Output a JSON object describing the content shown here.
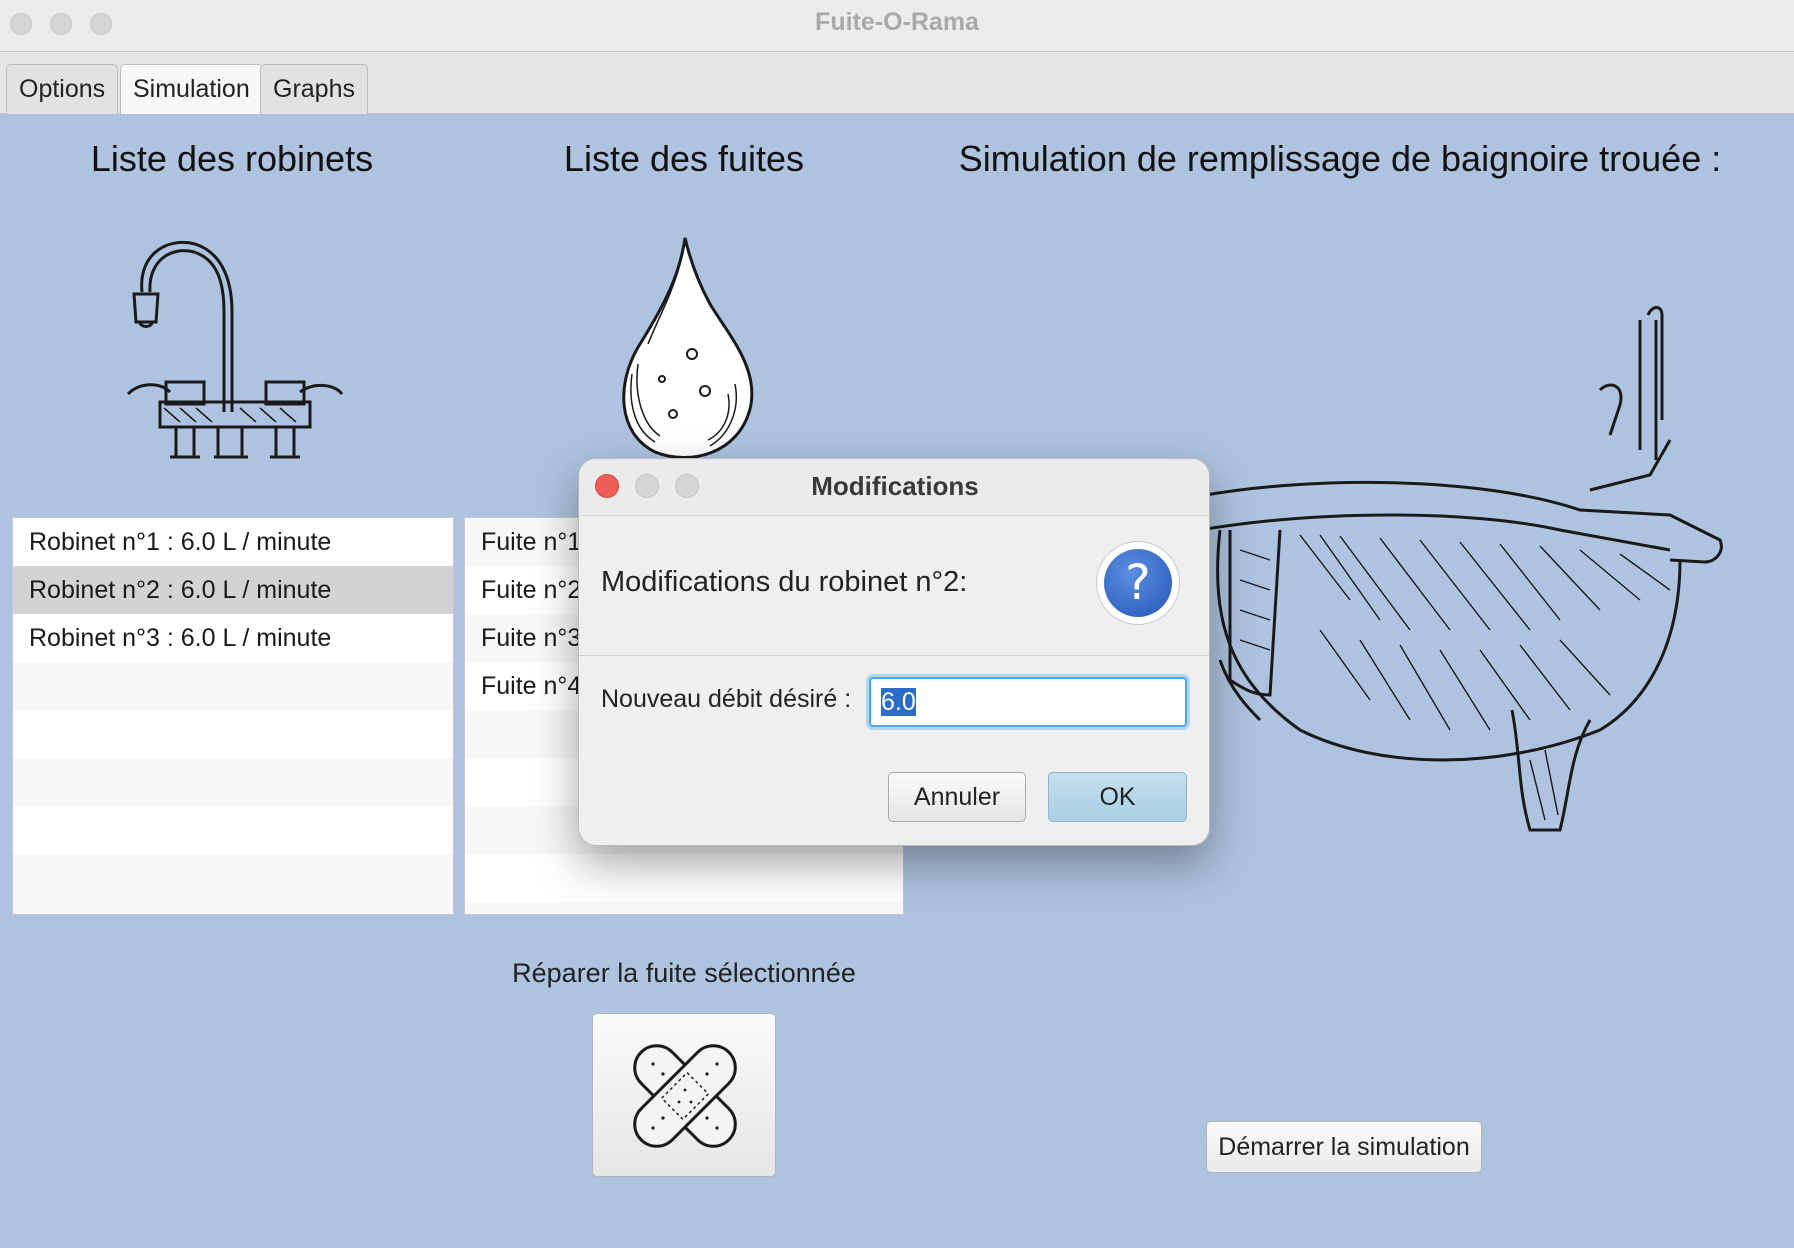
{
  "window": {
    "title": "Fuite-O-Rama"
  },
  "tabs": [
    {
      "label": "Options"
    },
    {
      "label": "Simulation"
    },
    {
      "label": "Graphs"
    }
  ],
  "sections": {
    "faucets_title": "Liste des robinets",
    "leaks_title": "Liste des fuites",
    "simulation_title": "Simulation de remplissage de baignoire trouée :"
  },
  "faucets": [
    "Robinet n°1 : 6.0 L / minute",
    "Robinet n°2 : 6.0 L / minute",
    "Robinet n°3 : 6.0 L / minute"
  ],
  "leaks": [
    "Fuite n°1:",
    "Fuite n°2",
    "Fuite n°3",
    "Fuite n°4"
  ],
  "repair": {
    "label": "Réparer la fuite sélectionnée"
  },
  "start_button": "Démarrer la simulation",
  "dialog": {
    "title": "Modifications",
    "message": "Modifications du robinet n°2:",
    "field_label": "Nouveau débit désiré :",
    "field_value": "6.0",
    "cancel": "Annuler",
    "ok": "OK"
  },
  "icons": {
    "faucet": "faucet-icon",
    "drop": "water-drop-icon",
    "bathtub": "bathtub-icon",
    "bandage": "bandage-icon",
    "question": "question-icon"
  },
  "colors": {
    "background": "#adc3df",
    "selection": "#d3d3d3",
    "ok_button": "#a9cfe4",
    "close_light": "#ec5e56",
    "question_icon": "#2457b8"
  }
}
